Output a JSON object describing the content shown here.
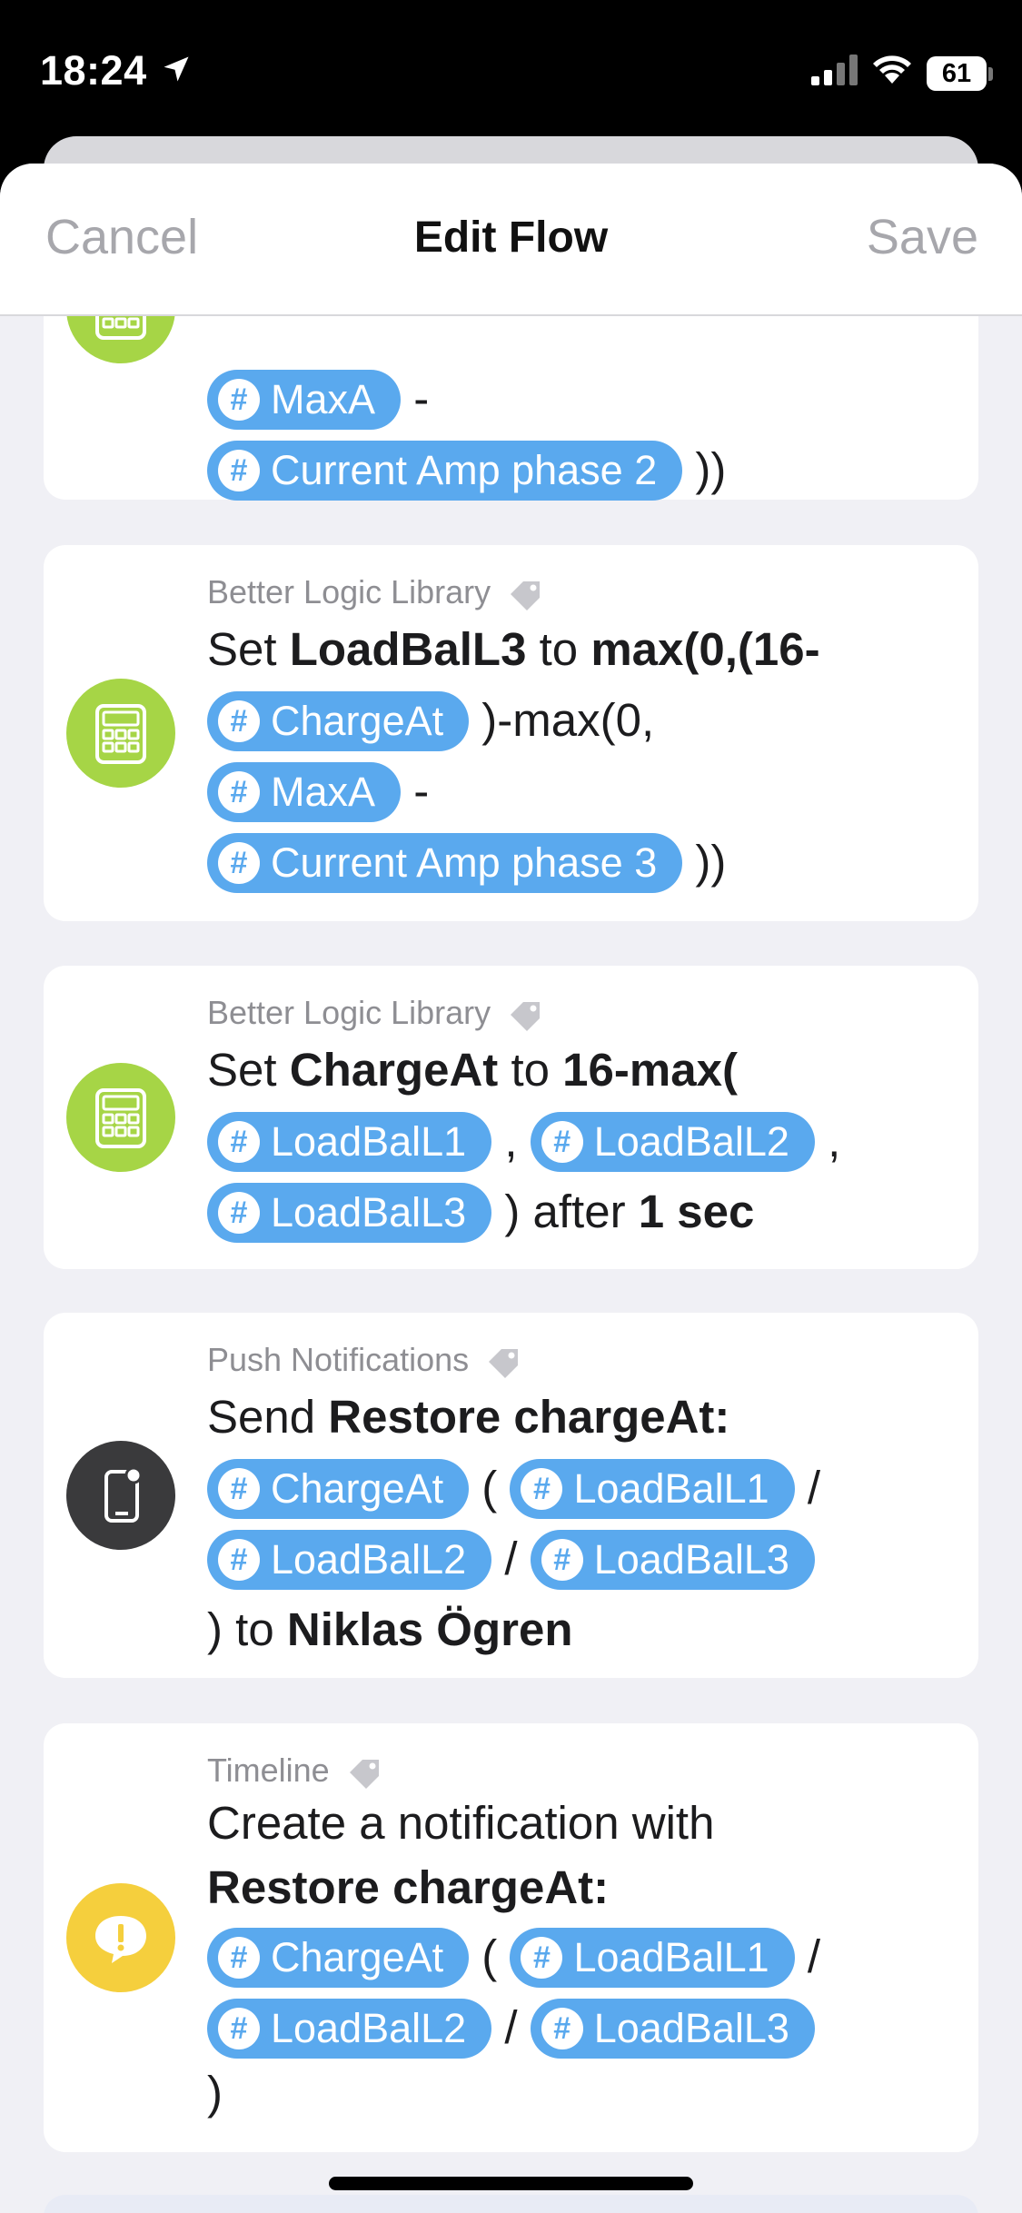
{
  "status_bar": {
    "time": "18:24",
    "battery": "61"
  },
  "nav": {
    "cancel": "Cancel",
    "title": "Edit Flow",
    "save": "Save"
  },
  "cards": [
    {
      "line2_token": "MaxA",
      "line3_token": "Current Amp phase 2",
      "line3_tail": "))"
    },
    {
      "source": "Better Logic Library",
      "l1_a": "Set",
      "l1_var": "LoadBalL3",
      "l1_b": "to",
      "l1_expr": "max(0,(16-",
      "l2_token": "ChargeAt",
      "l2_tail": ")-max(0,",
      "l3_token": "MaxA",
      "l3_tail": "-",
      "l4_token": "Current Amp phase 3",
      "l4_tail": "))"
    },
    {
      "source": "Better Logic Library",
      "l1_a": "Set",
      "l1_var": "ChargeAt",
      "l1_b": "to",
      "l1_expr": "16-max(",
      "l2_token1": "LoadBalL1",
      "l2_sep": ",",
      "l2_token2": "LoadBalL2",
      "l2_sep2": ",",
      "l3_token": "LoadBalL3",
      "l3_tail": ") after",
      "l3_dur": "1 sec"
    },
    {
      "source": "Push Notifications",
      "l1_a": "Send",
      "l1_msg": "Restore chargeAt:",
      "l2_token1": "ChargeAt",
      "l2_sep": "(",
      "l2_token2": "LoadBalL1",
      "l2_sep2": "/",
      "l3_token1": "LoadBalL2",
      "l3_sep": "/",
      "l3_token2": "LoadBalL3",
      "l4_a": ") to",
      "l4_user": "Niklas Ögren"
    },
    {
      "source": "Timeline",
      "l1": "Create a notification with",
      "l2": "Restore chargeAt:",
      "l3_token1": "ChargeAt",
      "l3_sep": "(",
      "l3_token2": "LoadBalL1",
      "l3_sep2": "/",
      "l4_token1": "LoadBalL2",
      "l4_sep": "/",
      "l4_token2": "LoadBalL3",
      "l5": ")"
    }
  ]
}
